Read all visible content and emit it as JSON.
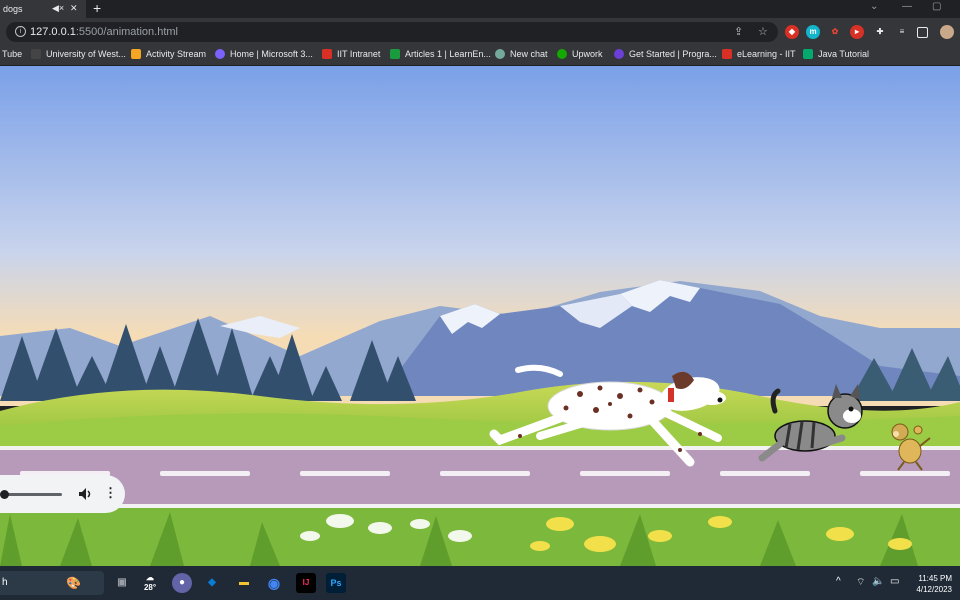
{
  "tab": {
    "title": "dogs",
    "mute_icon": "speaker-muted-icon",
    "close_icon": "close-icon"
  },
  "newtab": {
    "label": "+"
  },
  "address": {
    "host": "127.0.0.1",
    "path": ":5500/animation.html"
  },
  "bookmarks": [
    {
      "label": "Tube",
      "color": "#ff0000"
    },
    {
      "label": "University of West...",
      "color": "#444444"
    },
    {
      "label": "Activity Stream",
      "color": "#f5a623"
    },
    {
      "label": "Home | Microsoft 3...",
      "color": "#7b61ff"
    },
    {
      "label": "IIT Intranet",
      "color": "#d93025"
    },
    {
      "label": "Articles 1 | LearnEn...",
      "color": "#1a9c3e"
    },
    {
      "label": "New chat",
      "color": "#74aa9c"
    },
    {
      "label": "Upwork",
      "color": "#14a800"
    },
    {
      "label": "Get Started | Progra...",
      "color": "#6c3fd6"
    },
    {
      "label": "eLearning - IIT",
      "color": "#d93025"
    },
    {
      "label": "Java Tutorial",
      "color": "#04aa6d"
    }
  ],
  "taskbar": {
    "search_text": "h",
    "weather": "28°",
    "time": "11:45 PM",
    "date": "4/12/2023",
    "tray_chevron": "^",
    "apps": [
      {
        "name": "task-view",
        "label": "▣",
        "color": "#9aa0a6"
      },
      {
        "name": "teams",
        "label": "●",
        "color": "#6264a7"
      },
      {
        "name": "vscode",
        "label": "◆",
        "color": "#0a7cd4"
      },
      {
        "name": "explorer",
        "label": "▬",
        "color": "#f4c430"
      },
      {
        "name": "chrome",
        "label": "◉",
        "color": "#4285f4"
      },
      {
        "name": "intellij",
        "label": "IJ",
        "color": "#fe315d"
      },
      {
        "name": "photoshop",
        "label": "Ps",
        "color": "#31a8ff"
      }
    ]
  },
  "media": {
    "play_state": "playing",
    "progress": 0.0,
    "volume_icon": "volume-icon",
    "menu_icon": "more-vert-icon"
  },
  "colors": {
    "sky_top": "#7aa0e8",
    "sky_bottom": "#f6dcb4",
    "road": "#b79ab9",
    "grass": "#8cc63f"
  }
}
